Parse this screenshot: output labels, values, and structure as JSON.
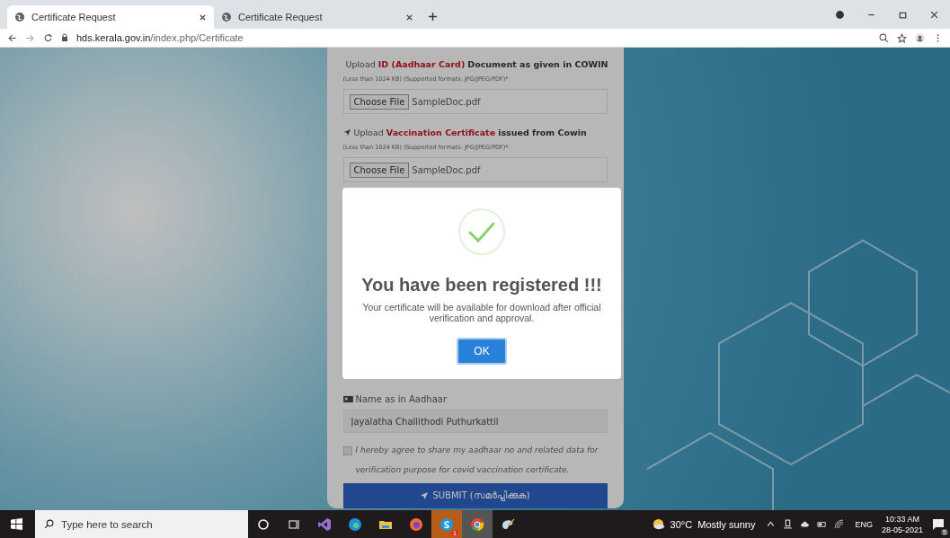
{
  "browser": {
    "tabs": [
      {
        "title": "Certificate Request",
        "selected": true
      },
      {
        "title": "Certificate Request",
        "selected": false
      }
    ],
    "url": {
      "domain": "hds.kerala.gov.in",
      "path": "/index.php/Certificate"
    }
  },
  "form": {
    "uploads": [
      {
        "lead": "Upload",
        "highlight": "ID (Aadhaar Card)",
        "rest": "Document as given in COWIN",
        "note": "(Less than 1024 KB) (Supported formats: JPG/JPEG/PDF)",
        "required_mark": "*",
        "button": "Choose File",
        "file": "SampleDoc.pdf"
      },
      {
        "lead": "Upload",
        "highlight": "Vaccination Certificate",
        "rest": "issued from Cowin",
        "note": "(Less than 1024 KB) (Supported formats: JPG/JPEG/PDF)",
        "required_mark": "*",
        "button": "Choose File",
        "file": "SampleDoc.pdf"
      }
    ],
    "name_label": "Name as in Aadhaar",
    "name_value": "Jayalatha Challithodi Puthurkattil",
    "agree": {
      "checked": false,
      "text": "I hereby agree to share my aadhaar no and related data for verification purpose for covid vaccination certificate."
    },
    "submit": "SUBMIT (സമർപ്പിക്കുക)"
  },
  "modal": {
    "title": "You have been registered !!!",
    "message": "Your certificate will be available for download after official verification and approval.",
    "button": "OK"
  },
  "taskbar": {
    "search_placeholder": "Type here to search",
    "apps": [
      {
        "kind": "cortana",
        "active": false
      },
      {
        "kind": "taskview",
        "active": false
      },
      {
        "kind": "vs",
        "active": false
      },
      {
        "kind": "edge",
        "active": false
      },
      {
        "kind": "explorer",
        "active": false
      },
      {
        "kind": "firefox",
        "active": false
      },
      {
        "kind": "skype",
        "active": true,
        "badge": "1"
      },
      {
        "kind": "chrome",
        "active": true
      },
      {
        "kind": "paint",
        "active": false
      }
    ],
    "weather": "30°C  Mostly sunny",
    "language": "ENG",
    "time": "10:33 AM",
    "date": "28-05-2021",
    "notifications": "5"
  }
}
